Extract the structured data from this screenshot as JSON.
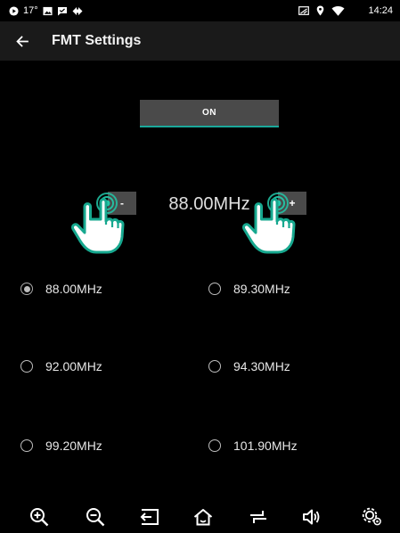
{
  "status_bar": {
    "temperature": "17°",
    "time": "14:24",
    "left_icons": [
      "play-circle-icon",
      "image-icon",
      "chat-icon",
      "navigation-icon"
    ],
    "right_icons": [
      "screen-cast-icon",
      "location-icon",
      "wifi-icon"
    ]
  },
  "app_bar": {
    "title": "FMT Settings",
    "back_icon": "arrow-left-icon"
  },
  "toggle": {
    "label": "ON",
    "accent_color": "#1aa89a"
  },
  "frequency": {
    "current": "88.00MHz",
    "decrement_label": "-",
    "increment_label": "+"
  },
  "presets": [
    {
      "label": "88.00MHz",
      "selected": true
    },
    {
      "label": "89.30MHz",
      "selected": false
    },
    {
      "label": "92.00MHz",
      "selected": false
    },
    {
      "label": "94.30MHz",
      "selected": false
    },
    {
      "label": "99.20MHz",
      "selected": false
    },
    {
      "label": "101.90MHz",
      "selected": false
    }
  ],
  "bottom_nav": [
    "zoom-in-icon",
    "zoom-out-icon",
    "back-icon",
    "home-icon",
    "switch-icon",
    "volume-icon",
    "settings-icon"
  ],
  "colors": {
    "background": "#000000",
    "app_bar": "#1a1a1a",
    "button": "#4a4a4a",
    "hand_fill": "#ffffff",
    "hand_outline": "#17a88f",
    "tap_glow": "#22c7a8"
  }
}
